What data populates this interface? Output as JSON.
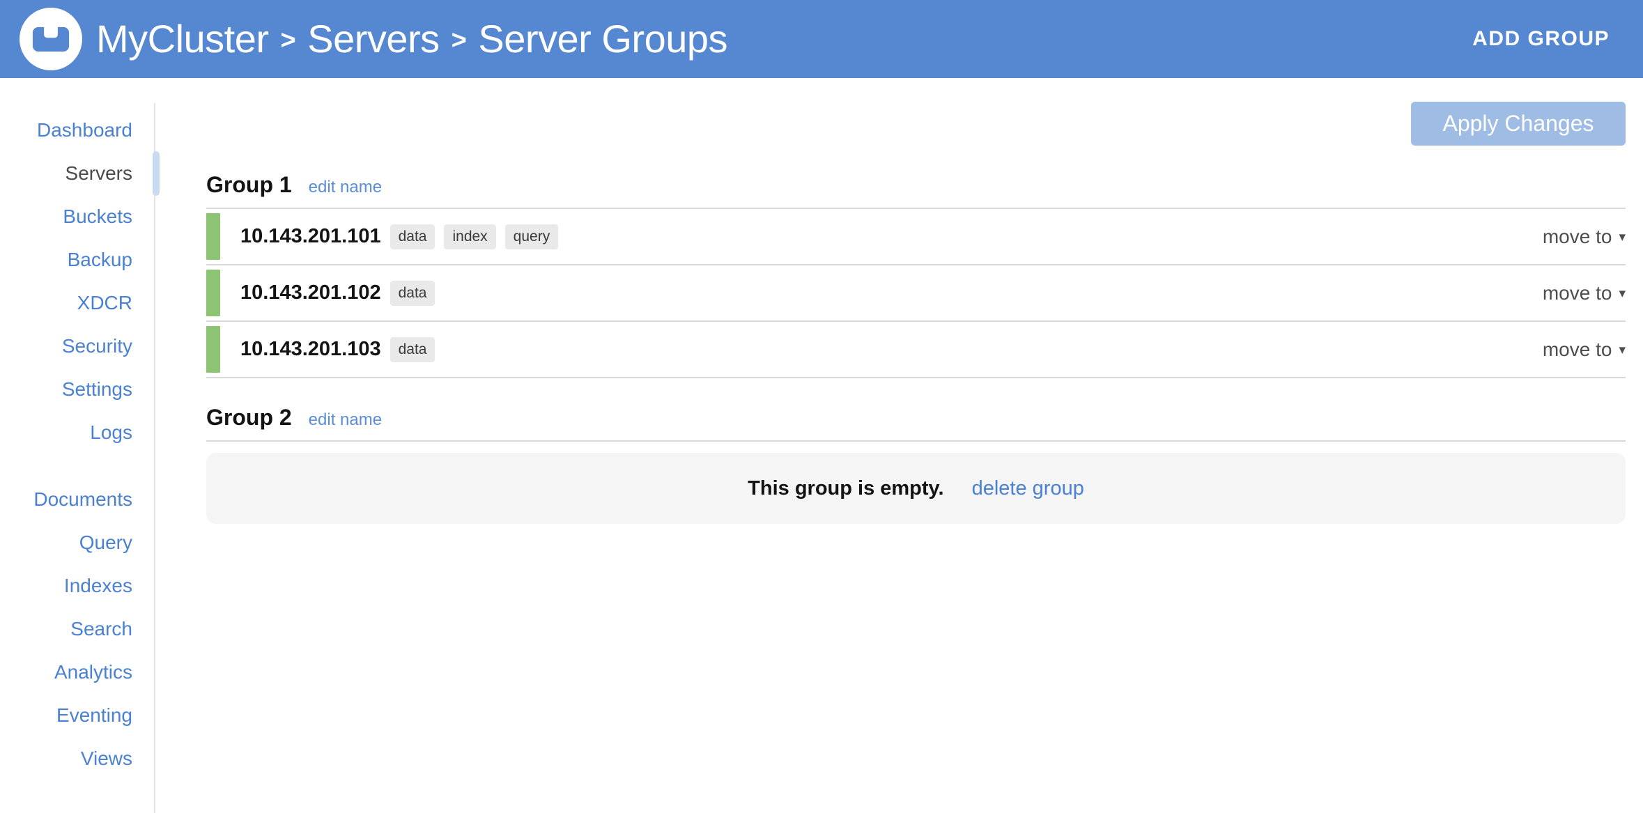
{
  "colors": {
    "header_bg": "#5687d1",
    "link_blue": "#4b81d2",
    "healthy_green": "#8cc474",
    "apply_disabled_bg": "#9fbce5",
    "active_nav_indicator": "#c9dbf2"
  },
  "header": {
    "breadcrumb": {
      "items": [
        "MyCluster",
        "Servers",
        "Server Groups"
      ],
      "separator": ">"
    },
    "add_group_label": "ADD GROUP"
  },
  "sidebar": {
    "top": [
      {
        "label": "Dashboard"
      },
      {
        "label": "Servers",
        "active": true
      },
      {
        "label": "Buckets"
      },
      {
        "label": "Backup"
      },
      {
        "label": "XDCR"
      },
      {
        "label": "Security"
      },
      {
        "label": "Settings"
      },
      {
        "label": "Logs"
      }
    ],
    "bottom": [
      {
        "label": "Documents"
      },
      {
        "label": "Query"
      },
      {
        "label": "Indexes"
      },
      {
        "label": "Search"
      },
      {
        "label": "Analytics"
      },
      {
        "label": "Eventing"
      },
      {
        "label": "Views"
      }
    ]
  },
  "main": {
    "apply_changes_label": "Apply Changes",
    "groups": [
      {
        "name": "Group 1",
        "edit_label": "edit name",
        "servers": [
          {
            "ip": "10.143.201.101",
            "services": [
              "data",
              "index",
              "query"
            ],
            "move_label": "move to"
          },
          {
            "ip": "10.143.201.102",
            "services": [
              "data"
            ],
            "move_label": "move to"
          },
          {
            "ip": "10.143.201.103",
            "services": [
              "data"
            ],
            "move_label": "move to"
          }
        ]
      },
      {
        "name": "Group 2",
        "edit_label": "edit name",
        "empty_text": "This group is empty.",
        "delete_label": "delete group"
      }
    ]
  }
}
